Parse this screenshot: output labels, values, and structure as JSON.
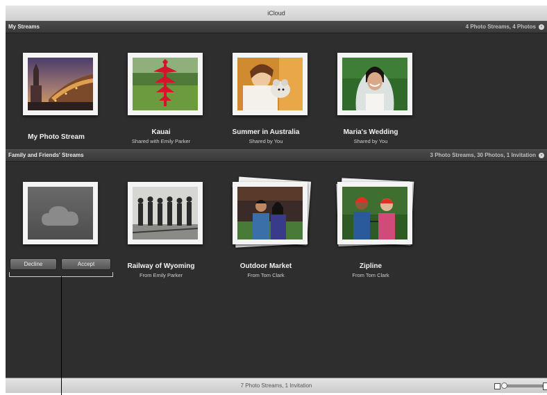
{
  "window": {
    "title": "iCloud"
  },
  "my_streams": {
    "header": "My Streams",
    "summary": "4 Photo Streams, 4 Photos",
    "items": [
      {
        "name": "My Photo Stream",
        "subtitle": ""
      },
      {
        "name": "Kauai",
        "subtitle": "Shared with Emily Parker"
      },
      {
        "name": "Summer in Australia",
        "subtitle": "Shared by You"
      },
      {
        "name": "Maria's Wedding",
        "subtitle": "Shared by You"
      }
    ]
  },
  "friends_streams": {
    "header": "Family and Friends' Streams",
    "summary": "3 Photo Streams, 30 Photos, 1 Invitation",
    "invitation": {
      "decline_label": "Decline",
      "accept_label": "Accept",
      "icon": "cloud-icon"
    },
    "items": [
      {
        "name": "Railway of Wyoming",
        "subtitle": "From Emily Parker"
      },
      {
        "name": "Outdoor Market",
        "subtitle": "From Tom Clark"
      },
      {
        "name": "Zipline",
        "subtitle": "From Tom Clark"
      }
    ]
  },
  "status_bar": {
    "text": "7 Photo Streams, 1 Invitation"
  },
  "colors": {
    "background": "#2e2e2e",
    "header": "#3f3f3f",
    "frame": "#f4f4f4"
  }
}
